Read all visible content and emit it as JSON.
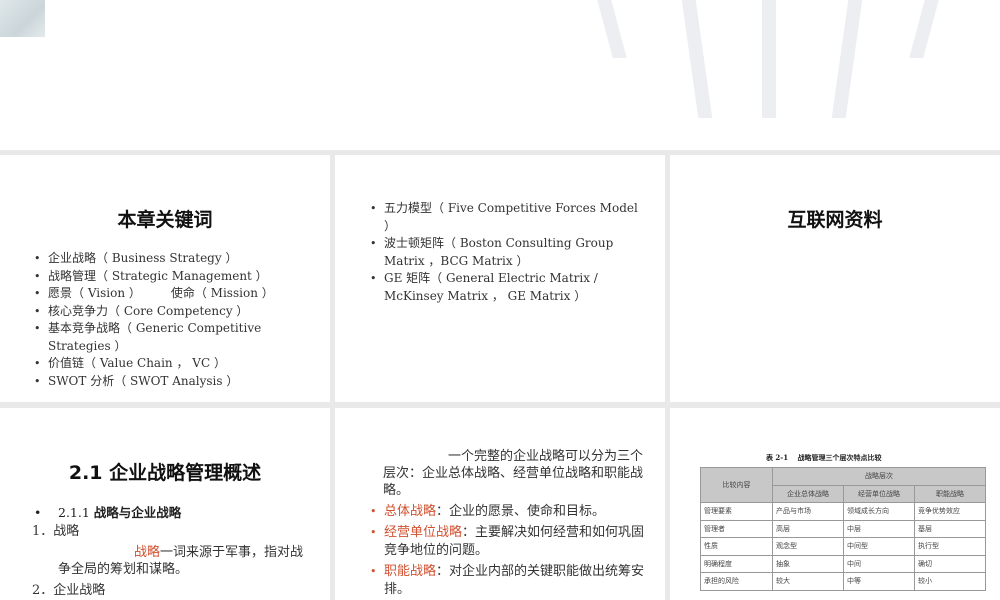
{
  "slide1": {
    "title": "本章关键词",
    "items": [
      "企业战略（ Business Strategy ）",
      "战略管理（ Strategic Management ）",
      "愿景（ Vision ）　　　使命（ Mission ）",
      "核心竞争力（ Core Competency ）",
      "基本竞争战略（ Generic Competitive Strategies ）",
      "价值链（ Value Chain ， VC ）",
      "SWOT 分析（ SWOT Analysis ）"
    ]
  },
  "slide2": {
    "items": [
      "五力模型（ Five Competitive Forces Model ）",
      "波士顿矩阵（ Boston Consulting Group Matrix ，BCG Matrix ）",
      "GE 矩阵（ General Electric Matrix / McKinsey Matrix ， GE Matrix ）"
    ]
  },
  "slide3": {
    "title": "互联网资料"
  },
  "slide4": {
    "title": "2.1 企业战略管理概述",
    "bullet_num": "2.1.1",
    "bullet": "战略与企业战略",
    "line1": "1．战略",
    "term": "战略",
    "desc": "一词来源于军事，指对战争全局的筹划和谋略。",
    "line2": "2．企业战略"
  },
  "slide5": {
    "intro": "一个完整的企业战略可以分为三个层次：企业总体战略、经营单位战略和职能战略。",
    "items": [
      {
        "term": "总体战略",
        "text": "：企业的愿景、使命和目标。"
      },
      {
        "term": "经营单位战略",
        "text": "：主要解决如何经营和如何巩固竞争地位的问题。"
      },
      {
        "term": "职能战略",
        "text": "：对企业内部的关键职能做出统筹安排。"
      }
    ]
  },
  "slide6": {
    "caption": "表 2-1　 战略管理三个层次特点比较",
    "col0": "比较内容",
    "group": "战略层次",
    "cols": [
      "企业总体战略",
      "经营单位战略",
      "职能战略"
    ],
    "rows": [
      [
        "管理要素",
        "产品与市场",
        "领域成长方向",
        "竞争优势效应"
      ],
      [
        "管理者",
        "高层",
        "中层",
        "基层"
      ],
      [
        "性质",
        "观念型",
        "中间型",
        "执行型"
      ],
      [
        "明确程度",
        "抽象",
        "中间",
        "确切"
      ],
      [
        "承担的风险",
        "较大",
        "中等",
        "较小"
      ]
    ]
  },
  "colors": {
    "accent": "#d0502f"
  }
}
